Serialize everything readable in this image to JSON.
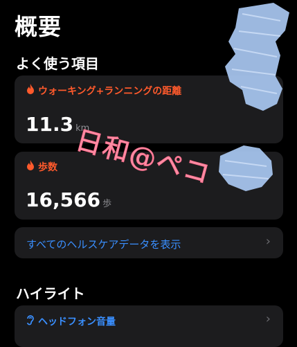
{
  "page": {
    "title": "概要"
  },
  "favorites": {
    "title": "よく使う項目",
    "cards": [
      {
        "label": "ウォーキング+ランニングの距離",
        "value": "11.3",
        "unit": "km",
        "icon": "flame-icon"
      },
      {
        "label": "歩数",
        "value": "16,566",
        "unit": "歩",
        "icon": "flame-icon"
      }
    ],
    "show_all_label": "すべてのヘルスケアデータを表示"
  },
  "highlights": {
    "title": "ハイライト",
    "item": {
      "label": "ヘッドフォン音量",
      "icon": "ear-icon"
    }
  },
  "watermark": "日和@ペコ",
  "colors": {
    "accent": "#ff5a2c",
    "link": "#3a8fff",
    "card_bg": "#1c1c1e",
    "scribble": "#a9c8f2"
  }
}
